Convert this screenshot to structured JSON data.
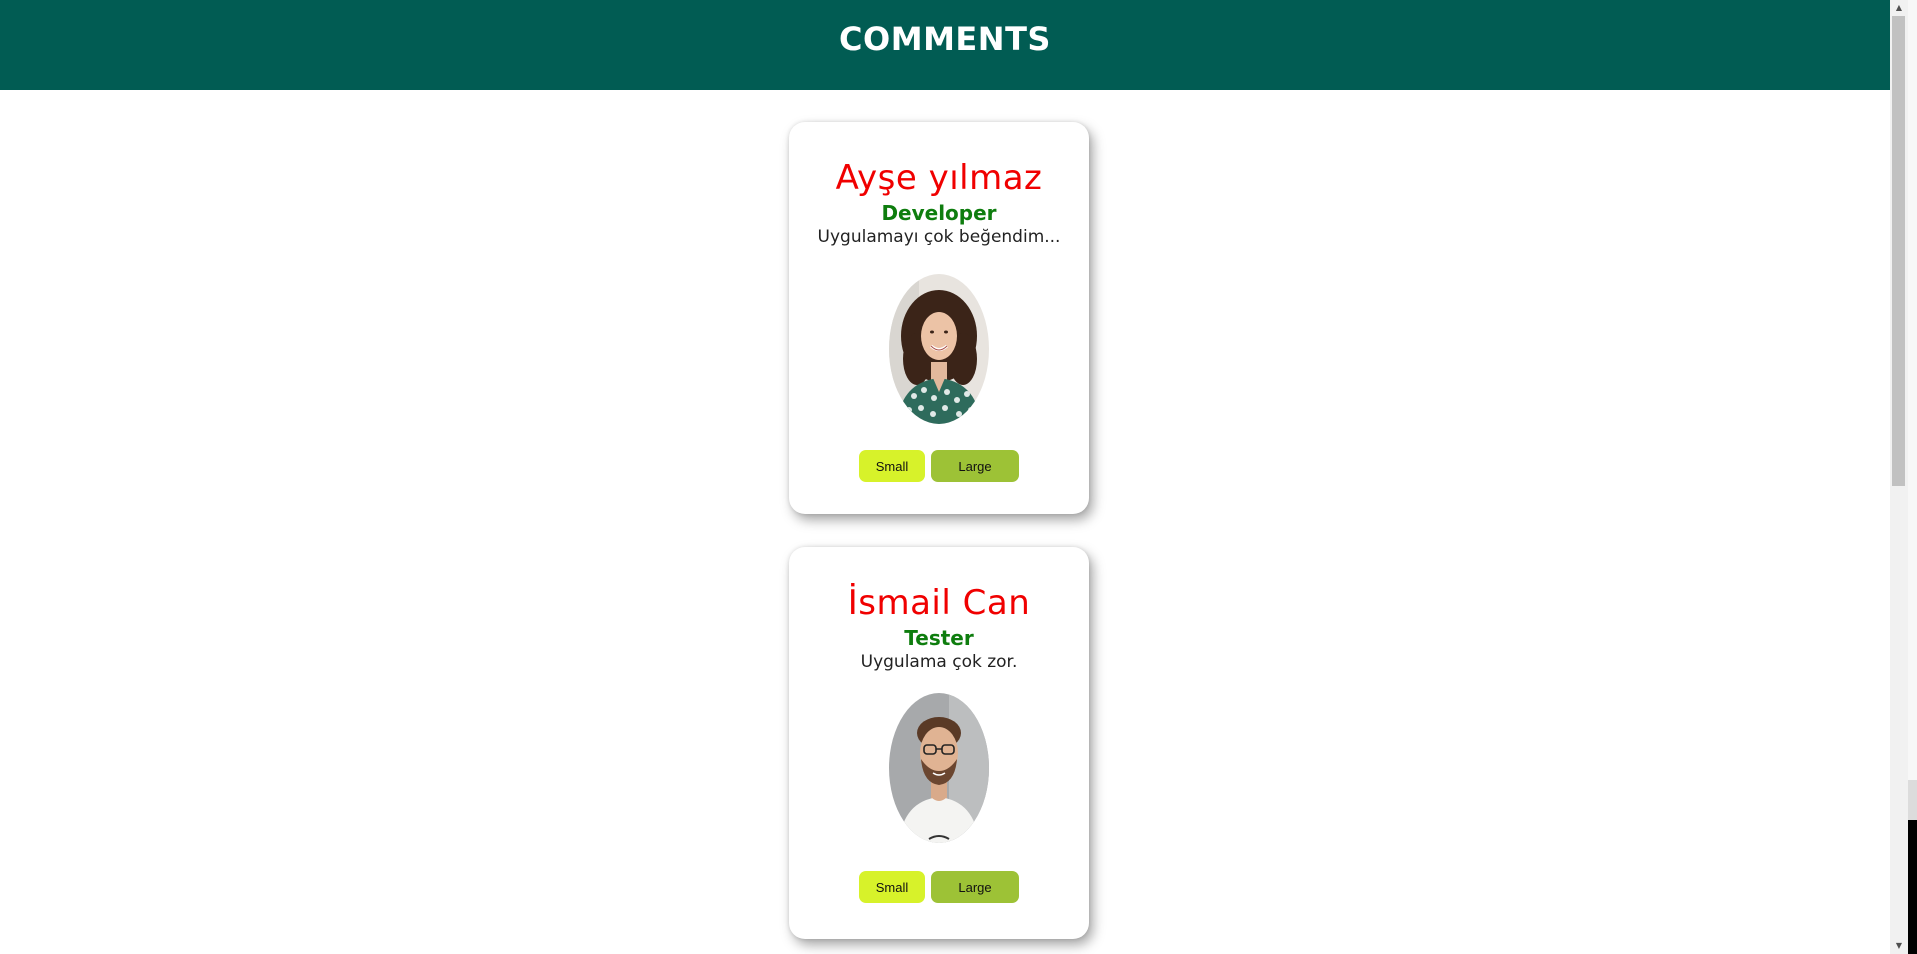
{
  "header": {
    "title": "COMMENTS"
  },
  "comments": [
    {
      "name": "Ayşe yılmaz",
      "role": "Developer",
      "comment": "Uygulamayı çok beğendim...",
      "avatar": "woman-portrait-photo",
      "buttons": {
        "small": "Small",
        "large": "Large"
      }
    },
    {
      "name": "İsmail Can",
      "role": "Tester",
      "comment": "Uygulama çok zor.",
      "avatar": "man-portrait-photo",
      "buttons": {
        "small": "Small",
        "large": "Large"
      }
    }
  ],
  "colors": {
    "header_bg": "#015c53",
    "name": "#f00000",
    "role": "#0e7d0e",
    "small_button": "#d7f22a",
    "large_button": "#9dc236"
  },
  "icons": {
    "scroll_up": "triangle-up-icon",
    "scroll_down": "triangle-down-icon"
  }
}
